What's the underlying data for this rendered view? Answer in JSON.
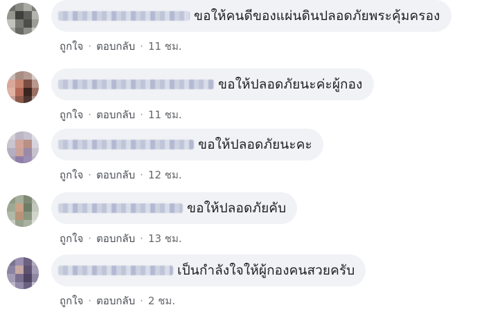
{
  "comments": [
    {
      "text": "ขอให้คนดีของแผ่นดินปลอดภัยพระคุ้มครอง",
      "like_label": "ถูกใจ",
      "reply_label": "ตอบกลับ",
      "separator": "·",
      "time": "11 ชม."
    },
    {
      "text": "ขอให้ปลอดภัยนะค่ะผู้กอง",
      "like_label": "ถูกใจ",
      "reply_label": "ตอบกลับ",
      "separator": "·",
      "time": "11 ชม."
    },
    {
      "text": "ขอให้ปลอดภัยนะคะ",
      "like_label": "ถูกใจ",
      "reply_label": "ตอบกลับ",
      "separator": "·",
      "time": "12 ชม."
    },
    {
      "text": "ขอให้ปลอดภัยคับ",
      "like_label": "ถูกใจ",
      "reply_label": "ตอบกลับ",
      "separator": "·",
      "time": "13 ชม."
    },
    {
      "text": "เป็นกำลังใจให้ผู้กองคนสวยครับ",
      "like_label": "ถูกใจ",
      "reply_label": "ตอบกลับ",
      "separator": "·",
      "time": "2 ชม."
    }
  ]
}
